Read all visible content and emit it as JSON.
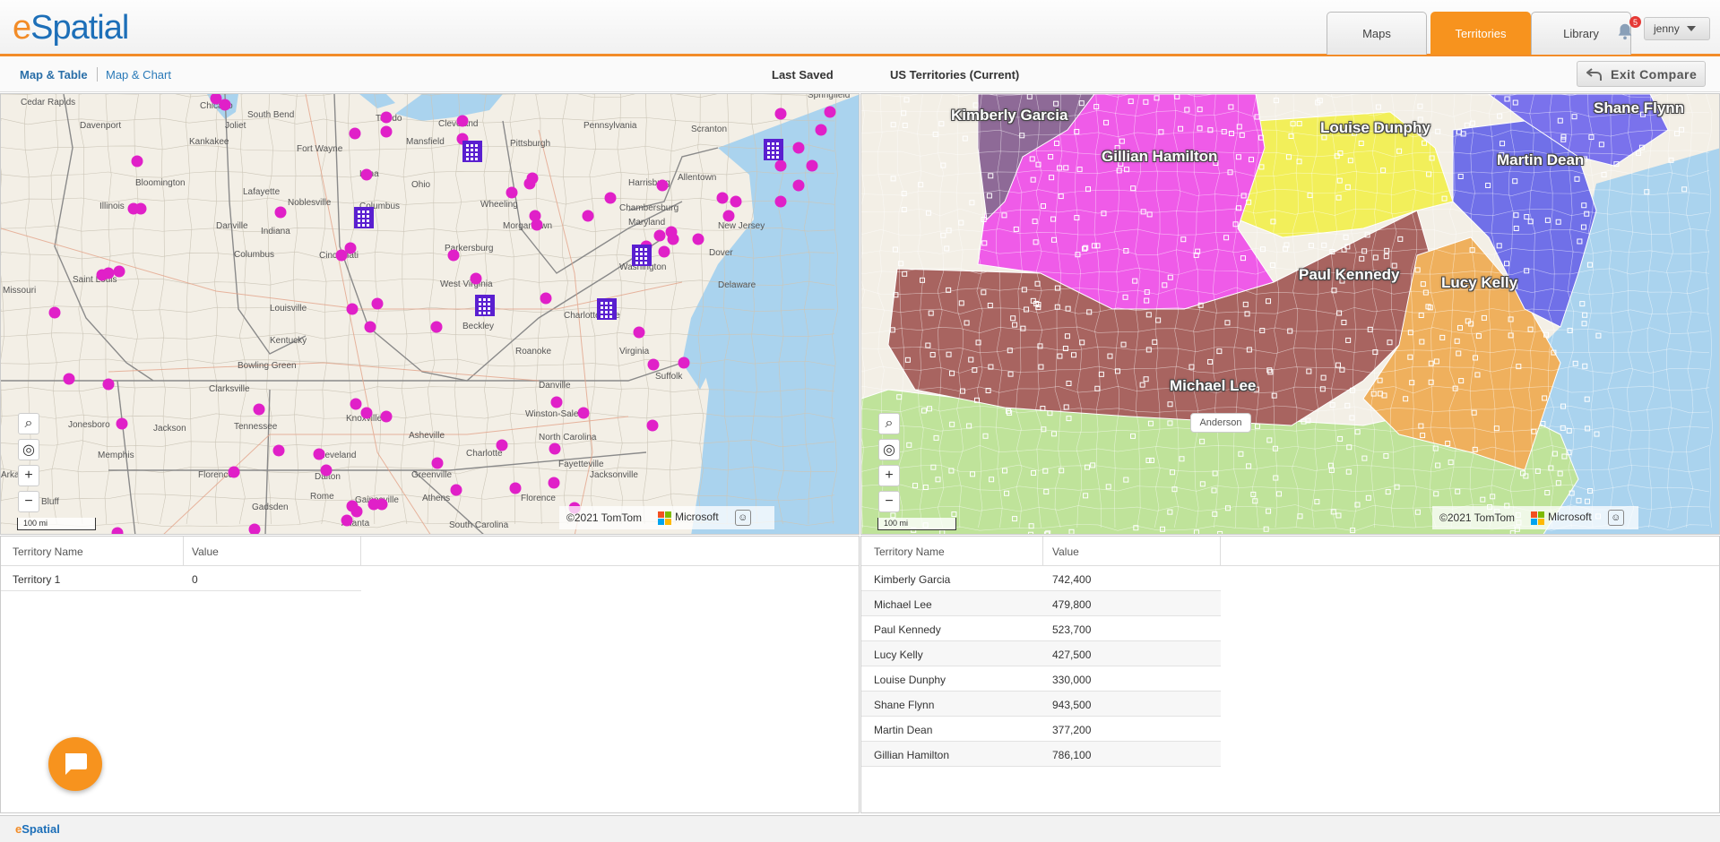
{
  "app": {
    "logo_e": "e",
    "logo_rest": "Spatial",
    "footer_logo": "eSpatial"
  },
  "nav": {
    "tabs": [
      {
        "label": "Maps",
        "active": false
      },
      {
        "label": "Territories",
        "active": true
      },
      {
        "label": "Library",
        "active": false
      }
    ],
    "notifications_count": "5",
    "user": "jenny"
  },
  "toolbar": {
    "view_map_table": "Map & Table",
    "view_map_chart": "Map & Chart",
    "last_saved": "Last Saved",
    "current_territory": "US Territories (Current)",
    "exit_compare": "Exit Compare"
  },
  "left_map": {
    "scale": "100 mi",
    "attribution": "©2021 TomTom",
    "provider": "Microsoft",
    "city_labels": [
      "Cedar Rapids",
      "Chicago",
      "South Bend",
      "Toledo",
      "Cleveland",
      "Pennsylvania",
      "Scranton",
      "Springfield",
      "Davenport",
      "Joliet",
      "Fort Wayne",
      "Mansfield",
      "Pittsburgh",
      "Allentown",
      "Kankakee",
      "Bloomington",
      "Lima",
      "Ohio",
      "Wheeling",
      "Harrisburg",
      "Illinois",
      "Danville",
      "Indiana",
      "Columbus",
      "Chambersburg",
      "Lafayette",
      "Noblesville",
      "Morgantown",
      "Maryland",
      "New Jersey",
      "Columbus",
      "Cincinnati",
      "Parkersburg",
      "Washington",
      "Dover",
      "Saint Louis",
      "West Virginia",
      "Delaware",
      "Missouri",
      "Louisville",
      "Beckley",
      "Charlottesville",
      "Kentucky",
      "Bowling Green",
      "Roanoke",
      "Virginia",
      "Clarksville",
      "Danville",
      "Suffolk",
      "Tennessee",
      "Knoxville",
      "Winston-Salem",
      "Jonesboro",
      "Jackson",
      "Asheville",
      "North Carolina",
      "Memphis",
      "Cleveland",
      "Charlotte",
      "Fayetteville",
      "Florence",
      "Dalton",
      "Greenville",
      "Jacksonville",
      "Gadsden",
      "Rome",
      "Gainesville",
      "Athens",
      "Florence",
      "Atlanta",
      "South Carolina",
      "Arkansas",
      "Bluff"
    ],
    "pin_color": "#e020c8",
    "office_color": "#5a1fd0"
  },
  "right_map": {
    "scale": "100 mi",
    "attribution": "©2021 TomTom",
    "provider": "Microsoft",
    "tooltip": "Anderson",
    "territories": [
      {
        "name": "Kimberly Garcia",
        "color": "#8e6a97"
      },
      {
        "name": "Gillian Hamilton",
        "color": "#ef5be8"
      },
      {
        "name": "Louise Dunphy",
        "color": "#f2ef5a"
      },
      {
        "name": "Shane Flynn",
        "color": "#7070e8"
      },
      {
        "name": "Martin Dean",
        "color": "#6b6be6"
      },
      {
        "name": "Paul Kennedy",
        "color": "#a86460"
      },
      {
        "name": "Lucy Kelly",
        "color": "#efb05d"
      },
      {
        "name": "Michael Lee",
        "color": "#bfe39a"
      }
    ]
  },
  "left_table": {
    "headers": [
      "Territory Name",
      "Value"
    ],
    "rows": [
      [
        "Territory 1",
        "0"
      ]
    ]
  },
  "right_table": {
    "headers": [
      "Territory Name",
      "Value"
    ],
    "rows": [
      [
        "Kimberly Garcia",
        "742,400"
      ],
      [
        "Michael Lee",
        "479,800"
      ],
      [
        "Paul Kennedy",
        "523,700"
      ],
      [
        "Lucy Kelly",
        "427,500"
      ],
      [
        "Louise Dunphy",
        "330,000"
      ],
      [
        "Shane Flynn",
        "943,500"
      ],
      [
        "Martin Dean",
        "377,200"
      ],
      [
        "Gillian Hamilton",
        "786,100"
      ]
    ]
  }
}
